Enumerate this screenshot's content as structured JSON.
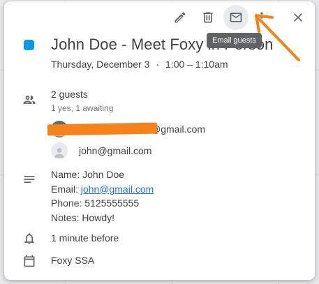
{
  "toolbar": {
    "edit_icon": "pencil-icon",
    "delete_icon": "trash-icon",
    "email_icon": "mail-icon",
    "more_icon": "more-vert-icon",
    "close_icon": "close-icon"
  },
  "tooltip": "Email guests",
  "event": {
    "color": "#039be5",
    "title": "John Doe - Meet Foxy in Person",
    "date": "Thursday, December 3",
    "separator": "·",
    "time": "1:00 – 1:10am"
  },
  "guests": {
    "count_label": "2 guests",
    "summary": "1 yes, 1 awaiting",
    "list": [
      {
        "email": "@gmail.com"
      },
      {
        "email": "john@gmail.com"
      }
    ]
  },
  "description": {
    "name_line": "Name: John Doe",
    "email_prefix": "Email: ",
    "email_link": "john@gmail.com",
    "phone_line": "Phone: 5125555555",
    "notes_line": "Notes: Howdy!"
  },
  "reminder": "1 minute before",
  "calendar_name": "Foxy SSA",
  "annotation_color": "#f7821b"
}
